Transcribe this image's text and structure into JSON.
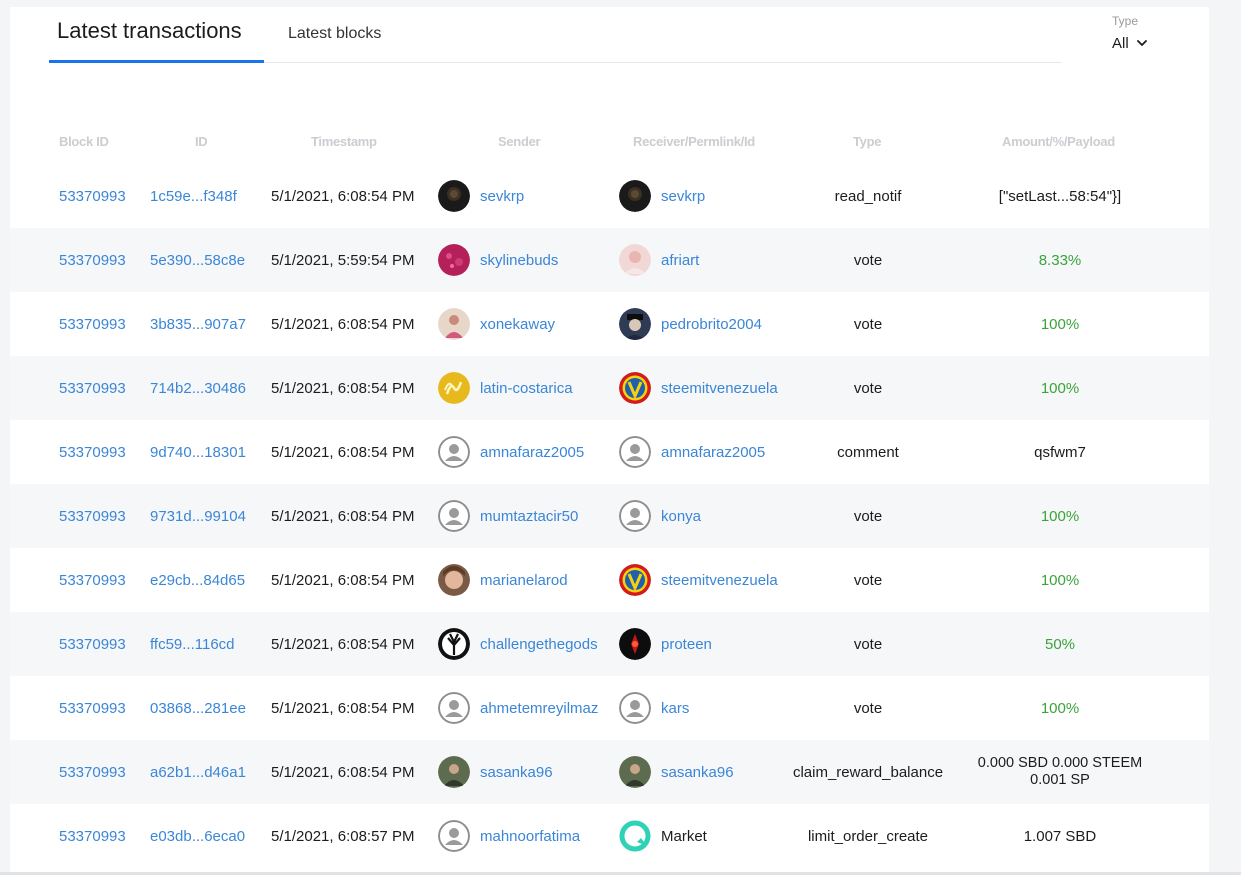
{
  "tabs": [
    {
      "label": "Latest transactions",
      "active": true
    },
    {
      "label": "Latest blocks",
      "active": false
    }
  ],
  "filter": {
    "label": "Type",
    "value": "All"
  },
  "columns": {
    "block_id": "Block ID",
    "id": "ID",
    "timestamp": "Timestamp",
    "sender": "Sender",
    "receiver": "Receiver/Permlink/Id",
    "type": "Type",
    "amount": "Amount/%/Payload"
  },
  "colors": {
    "link": "#3b86d6",
    "accent": "#1a73e8",
    "positive": "#3aa43a"
  },
  "rows": [
    {
      "block": "53370993",
      "id": "1c59e...f348f",
      "ts": "5/1/2021, 6:08:54 PM",
      "sender": "sevkrp",
      "sender_avatar": "dark-photo",
      "receiver": "sevkrp",
      "receiver_avatar": "dark-photo",
      "type": "read_notif",
      "amount": "[\"setLast...58:54\"}]",
      "amount_style": "dark"
    },
    {
      "block": "53370993",
      "id": "5e390...58c8e",
      "ts": "5/1/2021, 5:59:54 PM",
      "sender": "skylinebuds",
      "sender_avatar": "pink-photo",
      "receiver": "afriart",
      "receiver_avatar": "light-photo",
      "type": "vote",
      "amount": "8.33%",
      "amount_style": "green"
    },
    {
      "block": "53370993",
      "id": "3b835...907a7",
      "ts": "5/1/2021, 6:08:54 PM",
      "sender": "xonekaway",
      "sender_avatar": "person-photo",
      "receiver": "pedrobrito2004",
      "receiver_avatar": "hat-photo",
      "type": "vote",
      "amount": "100%",
      "amount_style": "green"
    },
    {
      "block": "53370993",
      "id": "714b2...30486",
      "ts": "5/1/2021, 6:08:54 PM",
      "sender": "latin-costarica",
      "sender_avatar": "gold-logo",
      "receiver": "steemitvenezuela",
      "receiver_avatar": "v-logo",
      "type": "vote",
      "amount": "100%",
      "amount_style": "green"
    },
    {
      "block": "53370993",
      "id": "9d740...18301",
      "ts": "5/1/2021, 6:08:54 PM",
      "sender": "amnafaraz2005",
      "sender_avatar": "default-user-icon",
      "receiver": "amnafaraz2005",
      "receiver_avatar": "default-user-icon",
      "type": "comment",
      "amount": "qsfwm7",
      "amount_style": "dark"
    },
    {
      "block": "53370993",
      "id": "9731d...99104",
      "ts": "5/1/2021, 6:08:54 PM",
      "sender": "mumtaztacir50",
      "sender_avatar": "default-user-icon",
      "receiver": "konya",
      "receiver_avatar": "default-user-icon",
      "type": "vote",
      "amount": "100%",
      "amount_style": "green"
    },
    {
      "block": "53370993",
      "id": "e29cb...84d65",
      "ts": "5/1/2021, 6:08:54 PM",
      "sender": "marianelarod",
      "sender_avatar": "face-photo",
      "receiver": "steemitvenezuela",
      "receiver_avatar": "v-logo",
      "type": "vote",
      "amount": "100%",
      "amount_style": "green"
    },
    {
      "block": "53370993",
      "id": "ffc59...116cd",
      "ts": "5/1/2021, 6:08:54 PM",
      "sender": "challengethegods",
      "sender_avatar": "tree-logo",
      "receiver": "proteen",
      "receiver_avatar": "red-logo",
      "type": "vote",
      "amount": "50%",
      "amount_style": "green"
    },
    {
      "block": "53370993",
      "id": "03868...281ee",
      "ts": "5/1/2021, 6:08:54 PM",
      "sender": "ahmetemreyilmaz",
      "sender_avatar": "default-user-icon",
      "receiver": "kars",
      "receiver_avatar": "default-user-icon",
      "type": "vote",
      "amount": "100%",
      "amount_style": "green"
    },
    {
      "block": "53370993",
      "id": "a62b1...d46a1",
      "ts": "5/1/2021, 6:08:54 PM",
      "sender": "sasanka96",
      "sender_avatar": "green-photo",
      "receiver": "sasanka96",
      "receiver_avatar": "green-photo",
      "type": "claim_reward_balance",
      "amount": "0.000 SBD 0.000 STEEM",
      "amount_line2": "0.001 SP",
      "amount_style": "dark"
    },
    {
      "block": "53370993",
      "id": "e03db...6eca0",
      "ts": "5/1/2021, 6:08:57 PM",
      "sender": "mahnoorfatima",
      "sender_avatar": "default-user-icon",
      "receiver": "Market",
      "receiver_avatar": "market-logo",
      "receiver_style": "dark",
      "type": "limit_order_create",
      "amount": "1.007 SBD",
      "amount_style": "dark"
    }
  ]
}
